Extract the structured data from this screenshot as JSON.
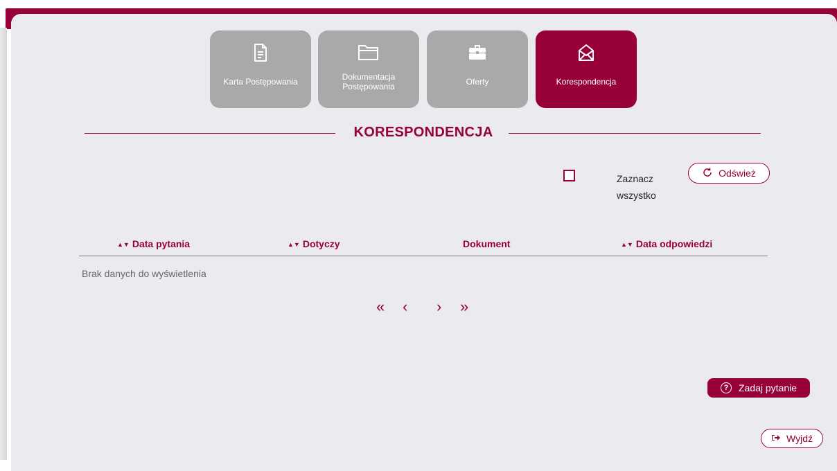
{
  "colors": {
    "brand": "#98003a",
    "tab_inactive": "#a9a9a9",
    "panel": "#ebebef"
  },
  "tabs": [
    {
      "label": "Karta Postępowania",
      "icon": "document-icon",
      "active": false
    },
    {
      "label": "Dokumentacja Postępowania",
      "icon": "folder-icon",
      "active": false
    },
    {
      "label": "Oferty",
      "icon": "briefcase-icon",
      "active": false
    },
    {
      "label": "Korespondencja",
      "icon": "envelope-open-icon",
      "active": true
    }
  ],
  "section_title": "KORESPONDENCJA",
  "controls": {
    "select_all_label": "Zaznacz wszystko",
    "refresh_label": "Odśwież"
  },
  "table": {
    "columns": [
      "Data pytania",
      "Dotyczy",
      "Dokument",
      "Data odpowiedzi"
    ],
    "sortable": [
      true,
      true,
      false,
      true
    ],
    "empty_text": "Brak danych do wyświetlenia"
  },
  "pagination": {
    "first": "«",
    "prev": "‹",
    "next": "›",
    "last": "»"
  },
  "ask_button_label": "Zadaj pytanie",
  "exit_button_label": "Wyjdź"
}
